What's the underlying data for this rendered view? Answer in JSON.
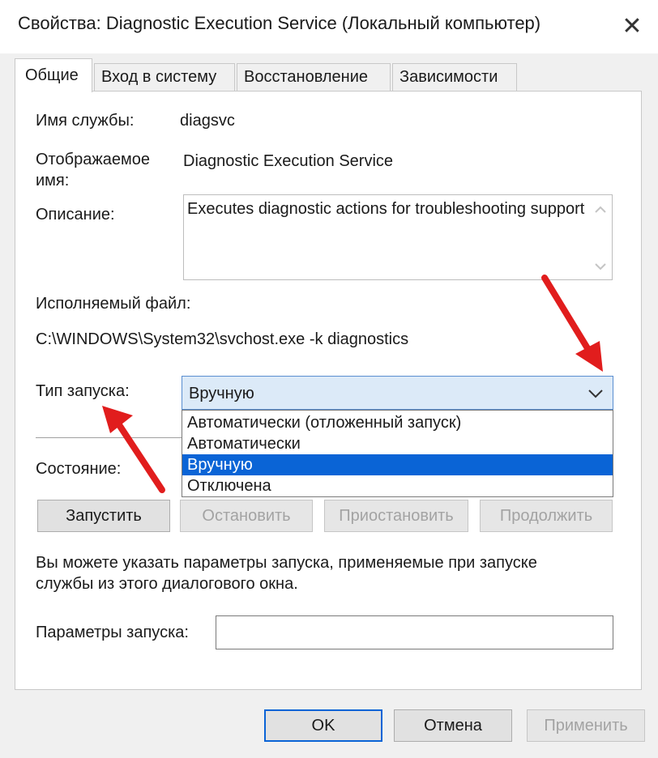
{
  "window": {
    "title": "Свойства: Diagnostic Execution Service (Локальный компьютер)",
    "close_glyph": "✕"
  },
  "tabs": [
    {
      "label": "Общие",
      "active": true
    },
    {
      "label": "Вход в систему",
      "active": false
    },
    {
      "label": "Восстановление",
      "active": false
    },
    {
      "label": "Зависимости",
      "active": false
    }
  ],
  "general": {
    "service_name_label": "Имя службы:",
    "service_name_value": "diagsvc",
    "display_name_label_line1": "Отображаемое",
    "display_name_label_line2": "имя:",
    "display_name_value": "Diagnostic Execution Service",
    "description_label": "Описание:",
    "description_value": "Executes diagnostic actions for troubleshooting support",
    "executable_label": "Исполняемый файл:",
    "executable_value": "C:\\WINDOWS\\System32\\svchost.exe -k diagnostics",
    "startup_type_label": "Тип запуска:",
    "startup_type_value": "Вручную",
    "startup_options": [
      "Автоматически (отложенный запуск)",
      "Автоматически",
      "Вручную",
      "Отключена"
    ],
    "startup_selected_index": 2,
    "status_label": "Состояние:",
    "buttons": {
      "start": "Запустить",
      "stop": "Остановить",
      "pause": "Приостановить",
      "resume": "Продолжить"
    },
    "hint_line1": "Вы можете указать параметры запуска, применяемые при запуске",
    "hint_line2": "службы из этого диалогового окна.",
    "params_label": "Параметры запуска:",
    "params_value": ""
  },
  "footer": {
    "ok": "OK",
    "cancel": "Отмена",
    "apply": "Применить"
  },
  "colors": {
    "accent": "#0a64d6",
    "annotation_arrow": "#e11d1d"
  }
}
